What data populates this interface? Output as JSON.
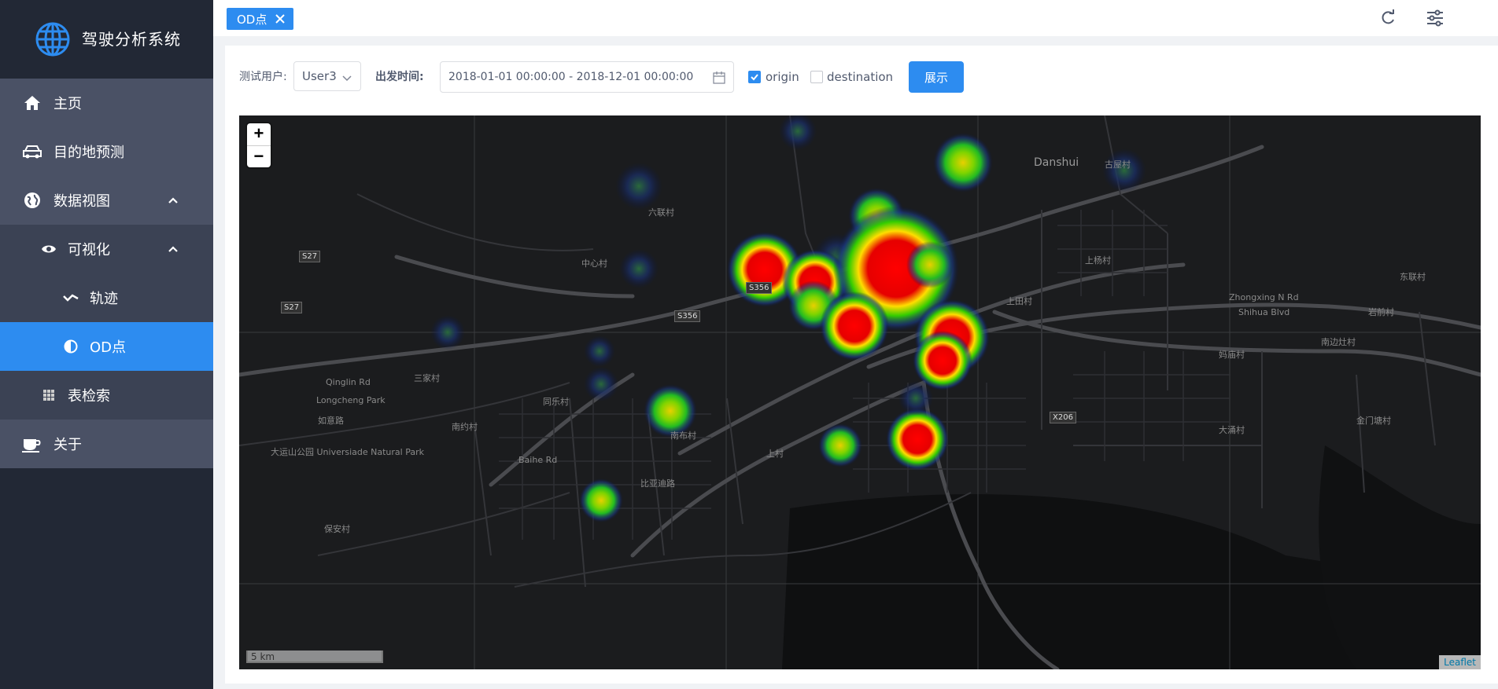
{
  "sidebar": {
    "app_title": "驾驶分析系统",
    "items": [
      {
        "label": "主页",
        "icon": "home-icon"
      },
      {
        "label": "目的地预测",
        "icon": "car-icon"
      },
      {
        "label": "数据视图",
        "icon": "globe-icon"
      },
      {
        "label": "可视化",
        "icon": "eye-icon"
      },
      {
        "label": "轨迹",
        "icon": "trajectory-icon"
      },
      {
        "label": "OD点",
        "icon": "contrast-icon"
      },
      {
        "label": "表检索",
        "icon": "grid-icon"
      },
      {
        "label": "关于",
        "icon": "coffee-icon"
      }
    ]
  },
  "header": {
    "tab_label": "OD点"
  },
  "filters": {
    "user_label": "测试用户:",
    "user_value": "User3",
    "time_label": "出发时间:",
    "time_range": "2018-01-01 00:00:00 - 2018-12-01 00:00:00",
    "origin_label": "origin",
    "origin_checked": true,
    "destination_label": "destination",
    "destination_checked": false,
    "show_button": "展示"
  },
  "map": {
    "zoom_in": "+",
    "zoom_out": "−",
    "scale_text": "5 km",
    "attribution": "Leaflet",
    "places": [
      "Danshui",
      "古屋村",
      "六联村",
      "中心村",
      "上杨村",
      "上田村",
      "东联村",
      "岩前村",
      "南边灶村",
      "妈庙村",
      "大涌村",
      "金门塘村",
      "三家村",
      "同乐村",
      "南约村",
      "南布村",
      "上村",
      "如意路",
      "Longcheng Park",
      "Qinglin Rd",
      "大运山公园 Universiade Natural Park",
      "保安村",
      "Shihua Blvd",
      "Baihe Rd",
      "Zhongxing N Rd",
      "比亚迪路"
    ],
    "road_shields": [
      "S27",
      "S27",
      "S356",
      "S356",
      "X206"
    ]
  }
}
